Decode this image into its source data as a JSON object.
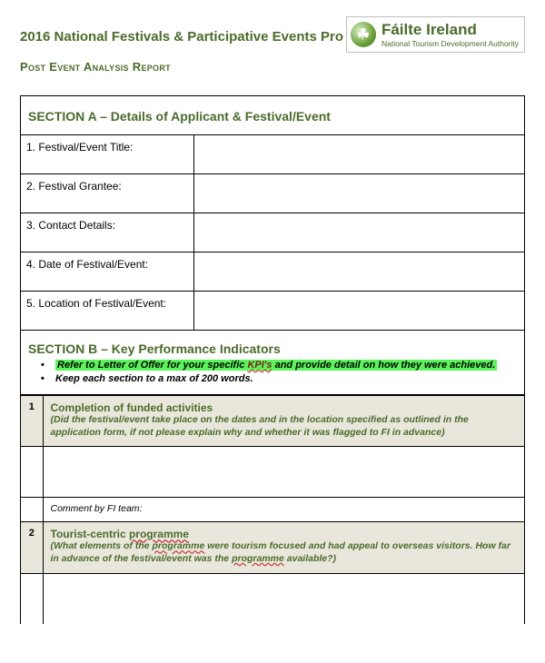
{
  "header": {
    "title": "2016 National Festivals & Participative Events Pro",
    "logo_main": "Fáilte Ireland",
    "logo_sub": "National Tourism Development Authority",
    "logo_glyph": "☘",
    "subtitle": "Post Event Analysis Report"
  },
  "sectionA": {
    "heading": "SECTION A – Details of Applicant & Festival/Event",
    "rows": [
      "1. Festival/Event Title:",
      "2. Festival Grantee:",
      "3. Contact Details:",
      "4. Date of Festival/Event:",
      "5. Location of Festival/Event:"
    ]
  },
  "sectionB": {
    "heading": "SECTION B – Key Performance Indicators",
    "bullet1_pre": "Refer to Letter of Offer for your specific ",
    "bullet1_kpi": "KPI's",
    "bullet1_post": " and provide detail on how they were achieved.",
    "bullet2": "Keep each section to a max of 200 words.",
    "items": [
      {
        "num": "1",
        "title": "Completion of funded activities",
        "desc": "(Did the festival/event take place on the dates and in the location specified as outlined in the application form, if not please explain why and whether it was flagged to FI in advance)",
        "comment_label": "Comment by FI team:"
      },
      {
        "num": "2",
        "title_pre": "Tourist-centric ",
        "title_prog": "programme",
        "desc_pre": "(What elements of the ",
        "desc_mid": " were tourism focused and had appeal to overseas visitors. How far in advance of the festival/event was the ",
        "desc_post": " available?)"
      }
    ]
  }
}
